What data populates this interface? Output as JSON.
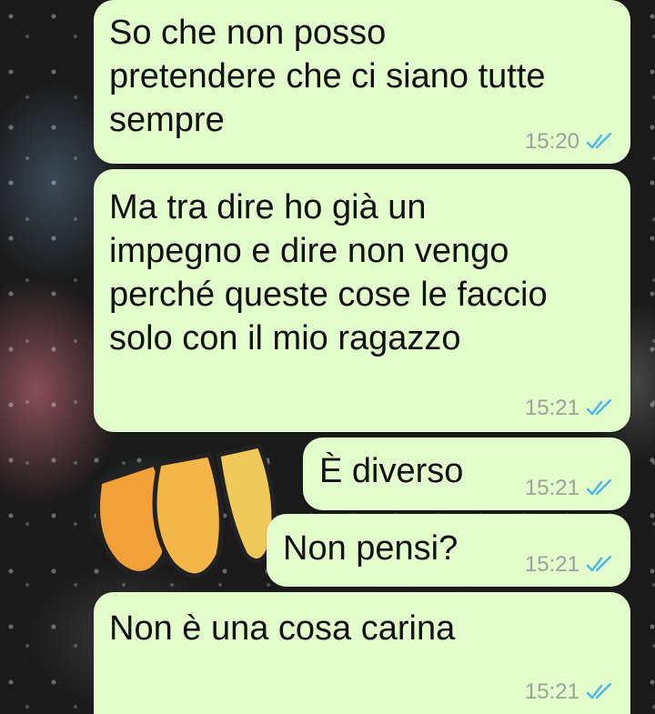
{
  "chat": {
    "messages": [
      {
        "text": "So che non posso\npretendere che ci siano tutte\nsempre",
        "time": "15:20",
        "status": "read"
      },
      {
        "text": "Ma tra dire ho già un\nimpegno e dire non vengo\nperché queste cose le faccio\nsolo con il mio ragazzo",
        "time": "15:21",
        "status": "read"
      },
      {
        "text": "È diverso",
        "time": "15:21",
        "status": "read"
      },
      {
        "text": "Non pensi?",
        "time": "15:21",
        "status": "read"
      },
      {
        "text": "Non è una cosa carina",
        "time": "15:21",
        "status": "read"
      }
    ]
  },
  "icons": {
    "read_receipt": "double-check-icon"
  },
  "colors": {
    "bubble": "#e2fdcb",
    "text": "#111111",
    "time": "#9aa399",
    "read_tick": "#4fb6ec"
  }
}
